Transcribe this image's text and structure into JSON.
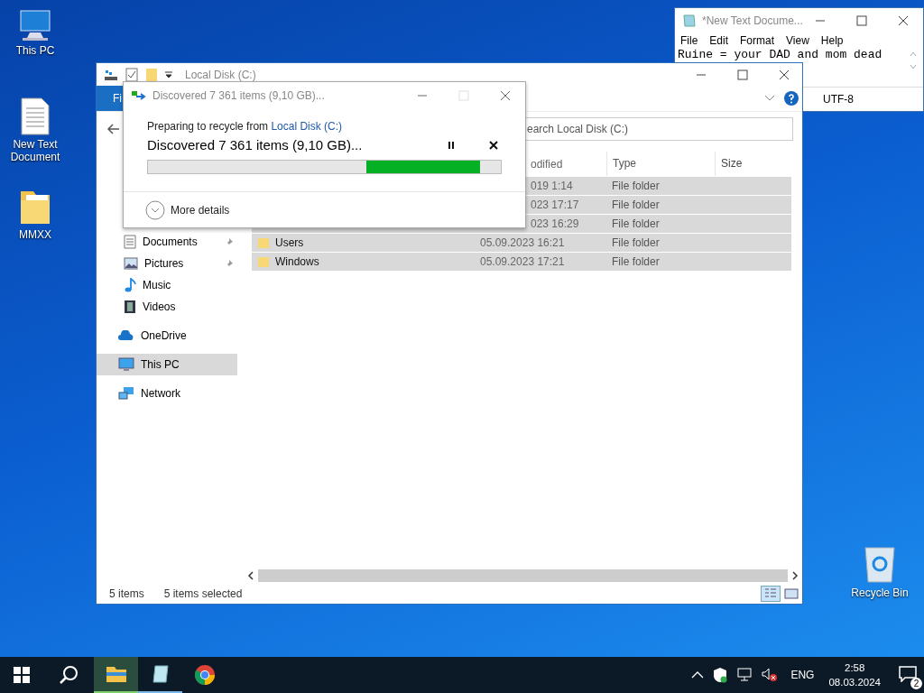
{
  "desktop_icons": [
    {
      "label": "This PC",
      "kind": "pc"
    },
    {
      "label": "New Text Document",
      "kind": "text"
    },
    {
      "label": "MMXX",
      "kind": "folder"
    },
    {
      "label": "Recycle Bin",
      "kind": "bin"
    }
  ],
  "notepad": {
    "title": "*New Text Docume...",
    "menu": [
      "File",
      "Edit",
      "Format",
      "View",
      "Help"
    ],
    "text": "Ruine = your DAD and mom dead",
    "encoding": "UTF-8"
  },
  "explorer": {
    "title": "Local Disk (C:)",
    "ribbon_tab": "Fi",
    "search": {
      "placeholder": "earch Local Disk (C:)"
    },
    "columns": [
      "odified",
      "Type",
      "Size"
    ],
    "nav": [
      {
        "label": "Documents",
        "kind": "documents",
        "pinned": true,
        "selected": false
      },
      {
        "label": "Pictures",
        "kind": "pictures",
        "pinned": true,
        "selected": false
      },
      {
        "label": "Music",
        "kind": "music",
        "pinned": false,
        "selected": false
      },
      {
        "label": "Videos",
        "kind": "videos",
        "pinned": false,
        "selected": false
      },
      {
        "label": "OneDrive",
        "kind": "cloud",
        "pinned": false,
        "selected": false
      },
      {
        "label": "This PC",
        "kind": "pc",
        "pinned": false,
        "selected": true
      },
      {
        "label": "Network",
        "kind": "network",
        "pinned": false,
        "selected": false
      }
    ],
    "rows": [
      {
        "date": "019 1:14",
        "type": "File folder",
        "selected": true
      },
      {
        "date": "023 17:17",
        "type": "File folder",
        "selected": true
      },
      {
        "date": "023 16:29",
        "type": "File folder",
        "selected": true
      },
      {
        "name": "Users",
        "date": "05.09.2023 16:21",
        "type": "File folder",
        "selected": true
      },
      {
        "name": "Windows",
        "date": "05.09.2023 17:21",
        "type": "File folder",
        "selected": true
      }
    ],
    "status": {
      "count": "5 items",
      "selection": "5 items selected"
    }
  },
  "dialog": {
    "title": "Discovered 7 361 items (9,10 GB)...",
    "prefix": "Preparing to recycle from ",
    "link": "Local Disk (C:)",
    "status": "Discovered 7 361 items (9,10 GB)...",
    "details": "More details"
  },
  "taskbar": {
    "apps": [
      {
        "kind": "explorer",
        "running": true,
        "active": true
      },
      {
        "kind": "notepad",
        "running": true,
        "active": false
      },
      {
        "kind": "chrome",
        "running": false,
        "active": false
      }
    ],
    "language": "ENG",
    "time": "2:58",
    "date": "08.03.2024",
    "notifications": "2"
  }
}
